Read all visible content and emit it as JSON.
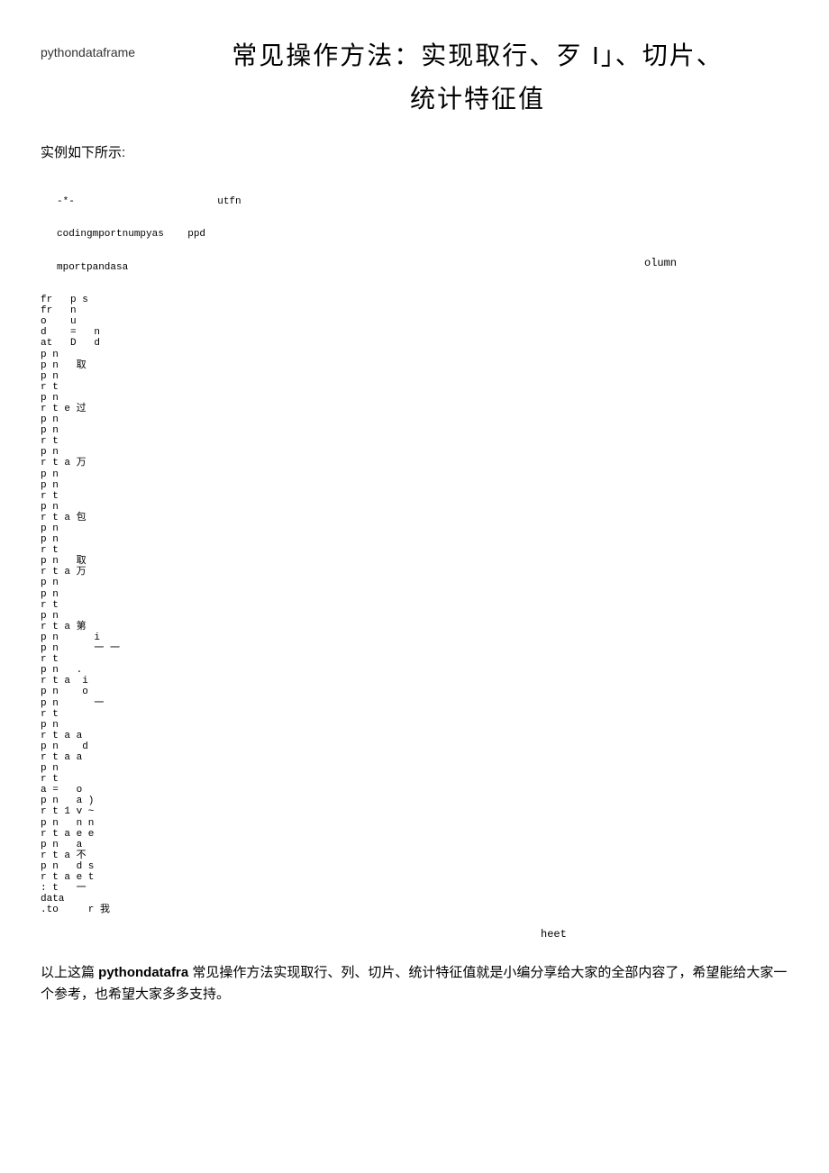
{
  "header": {
    "label": "pythondataframe",
    "title_line1": "常见操作方法：实现取行、歹 I」、切片、",
    "title_line2": "统计特征值"
  },
  "intro": "实例如下所示:",
  "code": {
    "line1": "-*-                        utfn",
    "line2": "codingmportnumpyas    ppd",
    "line3": "mportpandasa",
    "rest": "fr   p s\nfr   n\no    u\nd    =   n\nat   D   d\np n\np n   取\np n\nr t\np n\nr t e 过\np n\np n\nr t\np n\nr t a 万\np n\np n\nr t\np n\nr t a 包\np n\np n\nr t\np n   取\nr t a 万\np n\np n\nr t\np n\nr t a 第\np n      i\np n      一 一\nr t\np n   .\nr t a  i\np n    o\np n      一\nr t\np n\nr t a a\np n    d\nr t a a\np n\nr t\na =   o\np n   a )\nr t 1 v ~\np n   n n\nr t a e e\np n   a\nr t a 不\np n   d s\nr t a e t\n: t   一\ndata\n.to     r 我"
  },
  "float1": "olumn",
  "float2": "heet",
  "footer": {
    "prefix": "以上这篇 ",
    "bold": "pythondatafra",
    "rest": " 常见操作方法实现取行、列、切片、统计特征值就是小编分享给大家的全部内容了，希望能给大家一个参考，也希望大家多多支持。"
  }
}
